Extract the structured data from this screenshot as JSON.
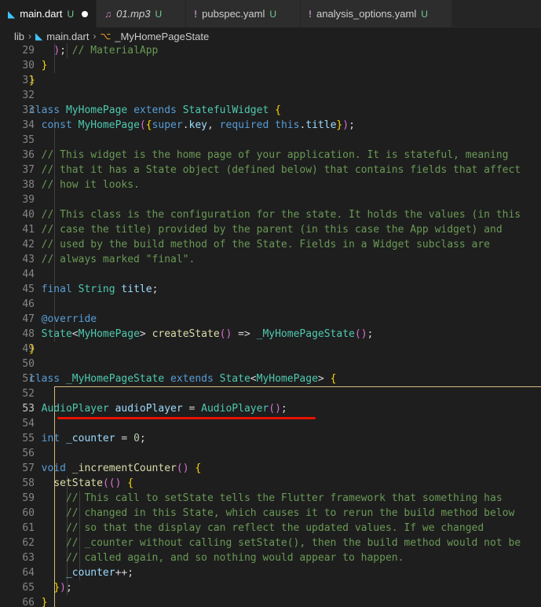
{
  "tabs": [
    {
      "name": "main.dart",
      "git": "U",
      "icon": "dart-icon",
      "active": true,
      "dirty": true,
      "italic": false
    },
    {
      "name": "01.mp3",
      "git": "U",
      "icon": "audio-file-icon",
      "active": false,
      "dirty": false,
      "italic": true
    },
    {
      "name": "pubspec.yaml",
      "git": "U",
      "icon": "yaml-icon",
      "active": false,
      "dirty": false,
      "italic": false
    },
    {
      "name": "analysis_options.yaml",
      "git": "U",
      "icon": "yaml-icon",
      "active": false,
      "dirty": false,
      "italic": false
    }
  ],
  "breadcrumb": {
    "folder": "lib",
    "file": "main.dart",
    "symbol": "_MyHomePageState"
  },
  "editor": {
    "current_line": 53,
    "line_numbers": [
      "29",
      "30",
      "31",
      "32",
      "33",
      "34",
      "35",
      "36",
      "37",
      "38",
      "39",
      "40",
      "41",
      "42",
      "43",
      "44",
      "45",
      "46",
      "47",
      "48",
      "49",
      "50",
      "51",
      "52",
      "53",
      "54",
      "55",
      "56",
      "57",
      "58",
      "59",
      "60",
      "61",
      "62",
      "63",
      "64",
      "65",
      "66"
    ],
    "lines": [
      "    ); // MaterialApp",
      "  }",
      "}",
      "",
      "class MyHomePage extends StatefulWidget {",
      "  const MyHomePage({super.key, required this.title});",
      "",
      "  // This widget is the home page of your application. It is stateful, meaning",
      "  // that it has a State object (defined below) that contains fields that affect",
      "  // how it looks.",
      "",
      "  // This class is the configuration for the state. It holds the values (in this",
      "  // case the title) provided by the parent (in this case the App widget) and",
      "  // used by the build method of the State. Fields in a Widget subclass are",
      "  // always marked \"final\".",
      "",
      "  final String title;",
      "",
      "  @override",
      "  State<MyHomePage> createState() => _MyHomePageState();",
      "}",
      "",
      "class _MyHomePageState extends State<MyHomePage> {",
      "",
      "  AudioPlayer audioPlayer = AudioPlayer();",
      "",
      "  int _counter = 0;",
      "",
      "  void _incrementCounter() {",
      "    setState(() {",
      "      // This call to setState tells the Flutter framework that something has",
      "      // changed in this State, which causes it to rerun the build method below",
      "      // so that the display can reflect the updated values. If we changed",
      "      // _counter without calling setState(), then the build method would not be",
      "      // called again, and so nothing would appear to happen.",
      "      _counter++;",
      "    });",
      "  }"
    ]
  }
}
